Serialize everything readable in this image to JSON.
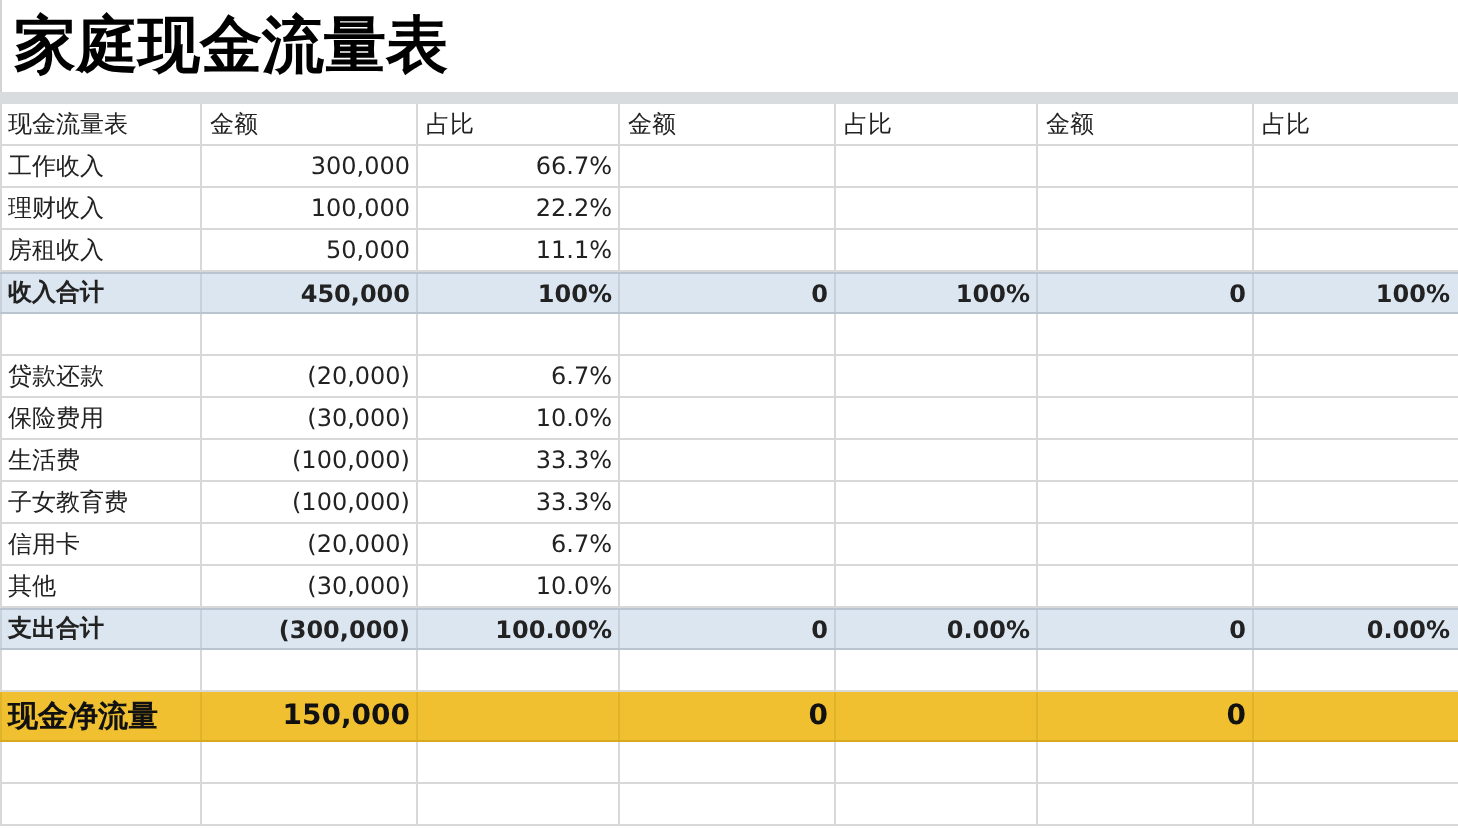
{
  "title": "家庭现金流量表",
  "columns": [
    "现金流量表",
    "金额",
    "占比",
    "金额",
    "占比",
    "金额",
    "占比"
  ],
  "rows": [
    {
      "kind": "item",
      "label": "工作收入",
      "values": [
        "300,000",
        "66.7%"
      ]
    },
    {
      "kind": "item",
      "label": "理财收入",
      "values": [
        "100,000",
        "22.2%"
      ]
    },
    {
      "kind": "item",
      "label": "房租收入",
      "values": [
        "50,000",
        "11.1%"
      ]
    },
    {
      "kind": "total",
      "label": "收入合计",
      "values": [
        "450,000",
        "100%",
        "0",
        "100%",
        "0",
        "100%"
      ]
    },
    {
      "kind": "blank"
    },
    {
      "kind": "item",
      "label": "贷款还款",
      "values": [
        "(20,000)",
        "6.7%"
      ]
    },
    {
      "kind": "item",
      "label": "保险费用",
      "values": [
        "(30,000)",
        "10.0%"
      ]
    },
    {
      "kind": "item",
      "label": "生活费",
      "values": [
        "(100,000)",
        "33.3%"
      ]
    },
    {
      "kind": "item",
      "label": "子女教育费",
      "values": [
        "(100,000)",
        "33.3%"
      ]
    },
    {
      "kind": "item",
      "label": "信用卡",
      "values": [
        "(20,000)",
        "6.7%"
      ]
    },
    {
      "kind": "item",
      "label": "其他",
      "values": [
        "(30,000)",
        "10.0%"
      ]
    },
    {
      "kind": "total",
      "label": "支出合计",
      "values": [
        "(300,000)",
        "100.00%",
        "0",
        "0.00%",
        "0",
        "0.00%"
      ]
    },
    {
      "kind": "blank"
    },
    {
      "kind": "net",
      "label": "现金净流量",
      "amounts": [
        "150,000",
        "0",
        "0"
      ]
    },
    {
      "kind": "blank"
    },
    {
      "kind": "blank"
    }
  ]
}
